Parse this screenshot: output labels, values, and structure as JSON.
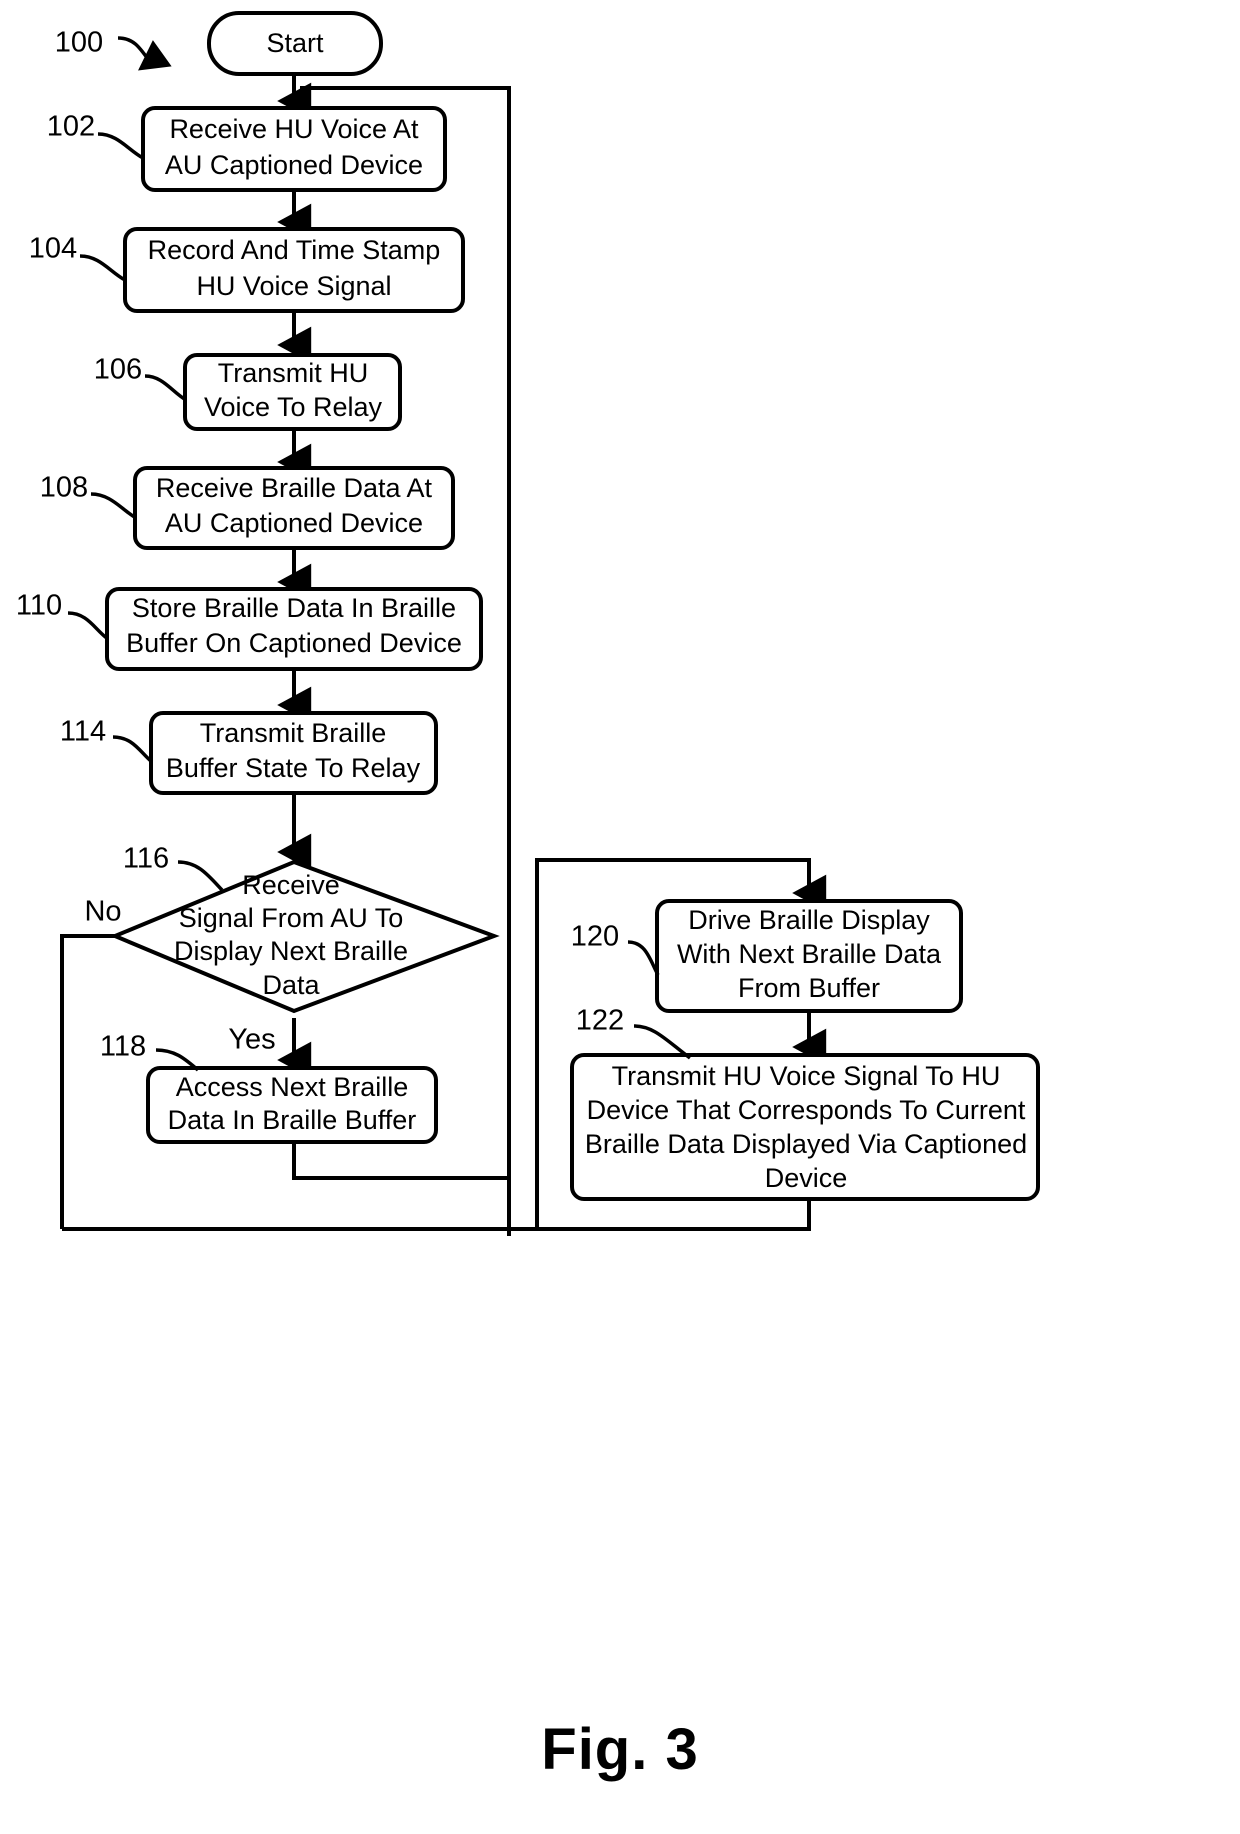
{
  "figure": {
    "caption": "Fig. 3",
    "diagram_label": "100"
  },
  "nodes": {
    "start": {
      "ref": "",
      "label": "Start",
      "shape": "terminator"
    },
    "n102": {
      "ref": "102",
      "lines": [
        "Receive HU Voice At",
        "AU Captioned Device"
      ],
      "shape": "process"
    },
    "n104": {
      "ref": "104",
      "lines": [
        "Record And Time Stamp",
        "HU Voice Signal"
      ],
      "shape": "process"
    },
    "n106": {
      "ref": "106",
      "lines": [
        "Transmit HU",
        "Voice To Relay"
      ],
      "shape": "process"
    },
    "n108": {
      "ref": "108",
      "lines": [
        "Receive Braille Data At",
        "AU Captioned Device"
      ],
      "shape": "process"
    },
    "n110": {
      "ref": "110",
      "lines": [
        "Store Braille Data In Braille",
        "Buffer On Captioned Device"
      ],
      "shape": "process"
    },
    "n114": {
      "ref": "114",
      "lines": [
        "Transmit Braille",
        "Buffer State To Relay"
      ],
      "shape": "process"
    },
    "n116": {
      "ref": "116",
      "lines": [
        "Receive",
        "Signal From AU To",
        "Display Next Braille",
        "Data"
      ],
      "shape": "decision"
    },
    "n118": {
      "ref": "118",
      "lines": [
        "Access Next Braille",
        "Data In Braille Buffer"
      ],
      "shape": "process"
    },
    "n120": {
      "ref": "120",
      "lines": [
        "Drive Braille Display",
        "With Next Braille Data",
        "From Buffer"
      ],
      "shape": "process"
    },
    "n122": {
      "ref": "122",
      "lines": [
        "Transmit HU Voice Signal To HU",
        "Device That Corresponds To Current",
        "Braille Data Displayed Via Captioned",
        "Device"
      ],
      "shape": "process"
    }
  },
  "branch_labels": {
    "no": "No",
    "yes": "Yes"
  },
  "colors": {
    "line": "#000000",
    "fill": "#ffffff",
    "text": "#000000"
  }
}
